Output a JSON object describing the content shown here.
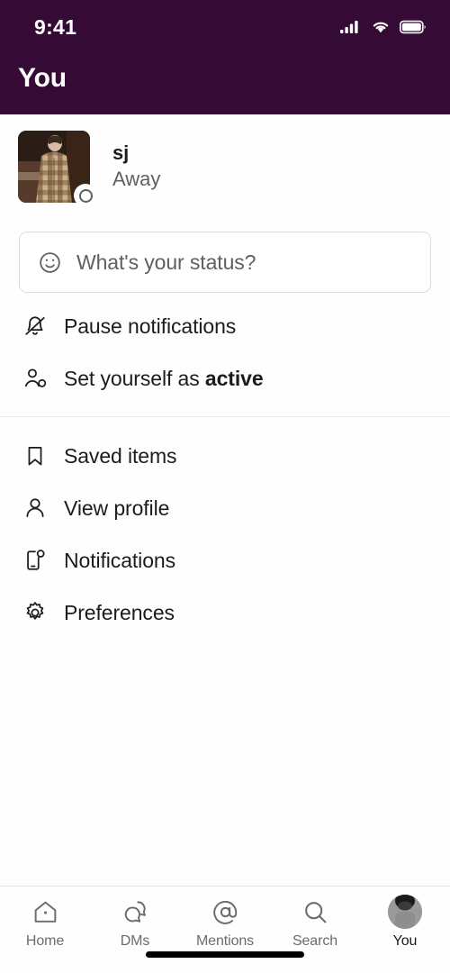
{
  "colors": {
    "header_bg": "#350A34",
    "page_bg": "#fefefe",
    "text_primary": "#1d1c1d",
    "text_secondary": "#616061",
    "tab_label": "#6b6b6b",
    "divider": "#e8e8e8",
    "border": "#dddddd"
  },
  "status_bar": {
    "time": "9:41",
    "icons": [
      "cellular-signal-icon",
      "wifi-icon",
      "battery-icon"
    ]
  },
  "header": {
    "title": "You"
  },
  "profile": {
    "avatar_alt": "user-avatar-photo",
    "display_name": "sj",
    "presence": "Away",
    "presence_icon": "away-circle-icon"
  },
  "status_input": {
    "placeholder": "What's your status?",
    "value": "",
    "icon": "emoji-smiley-icon"
  },
  "menu": {
    "group_one": [
      {
        "id": "pause-notifications",
        "icon": "bell-slash-icon",
        "label": "Pause notifications",
        "bold_suffix": ""
      },
      {
        "id": "set-yourself-active",
        "icon": "person-status-icon",
        "label": "Set yourself as ",
        "bold_suffix": "active"
      }
    ],
    "group_two": [
      {
        "id": "saved-items",
        "icon": "bookmark-icon",
        "label": "Saved items"
      },
      {
        "id": "view-profile",
        "icon": "person-icon",
        "label": "View profile"
      },
      {
        "id": "notifications",
        "icon": "mobile-alert-icon",
        "label": "Notifications"
      },
      {
        "id": "preferences",
        "icon": "gear-icon",
        "label": "Preferences"
      }
    ]
  },
  "tabbar": {
    "active": "you",
    "tabs": [
      {
        "id": "home",
        "icon": "home-icon",
        "label": "Home"
      },
      {
        "id": "dms",
        "icon": "speech-bubbles-icon",
        "label": "DMs"
      },
      {
        "id": "mentions",
        "icon": "at-sign-icon",
        "label": "Mentions"
      },
      {
        "id": "search",
        "icon": "magnifier-icon",
        "label": "Search"
      },
      {
        "id": "you",
        "icon": "avatar-icon",
        "label": "You"
      }
    ]
  }
}
